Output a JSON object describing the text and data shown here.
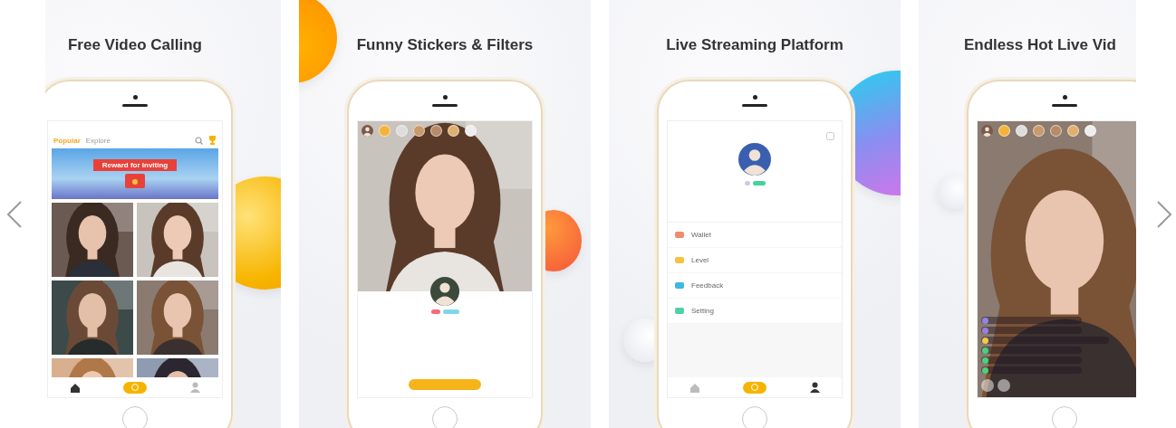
{
  "carousel": {
    "slides": [
      {
        "kind": "feed",
        "caption": "Free Video Calling",
        "tabs": [
          {
            "label": "Popular",
            "selected": true
          },
          {
            "label": "Explore",
            "selected": false
          }
        ],
        "banner": "Reward for Inviting",
        "tiles": [
          {
            "kind": "picture"
          },
          {
            "kind": "picture"
          },
          {
            "kind": "picture"
          },
          {
            "kind": "picture"
          },
          {
            "kind": "picture"
          },
          {
            "kind": "picture"
          }
        ],
        "nav": [
          {
            "kind": "home",
            "selected": true
          },
          {
            "kind": "camera",
            "selected": false
          },
          {
            "kind": "profile",
            "selected": false
          }
        ]
      },
      {
        "kind": "profile",
        "caption": "Funny Stickers & Filters"
      },
      {
        "kind": "account",
        "caption": "Live Streaming Platform",
        "menu": [
          {
            "label": "Wallet",
            "color": "#f28b6c"
          },
          {
            "label": "Level",
            "color": "#f5c242"
          },
          {
            "label": "Feedback",
            "color": "#3db7e4"
          },
          {
            "label": "Setting",
            "color": "#4fd1a5"
          }
        ],
        "nav": [
          {
            "kind": "home",
            "selected": false
          },
          {
            "kind": "camera",
            "selected": false
          },
          {
            "kind": "profile",
            "selected": true
          }
        ]
      },
      {
        "kind": "live",
        "caption": "Endless Hot Live Vid",
        "chat": [
          {
            "color": "#8f86e6"
          },
          {
            "color": "#9b7fe0"
          },
          {
            "color": "#f2c94c"
          },
          {
            "color": "#4cd07d"
          },
          {
            "color": "#4cd07d"
          },
          {
            "color": "#4cd07d"
          }
        ]
      }
    ]
  }
}
